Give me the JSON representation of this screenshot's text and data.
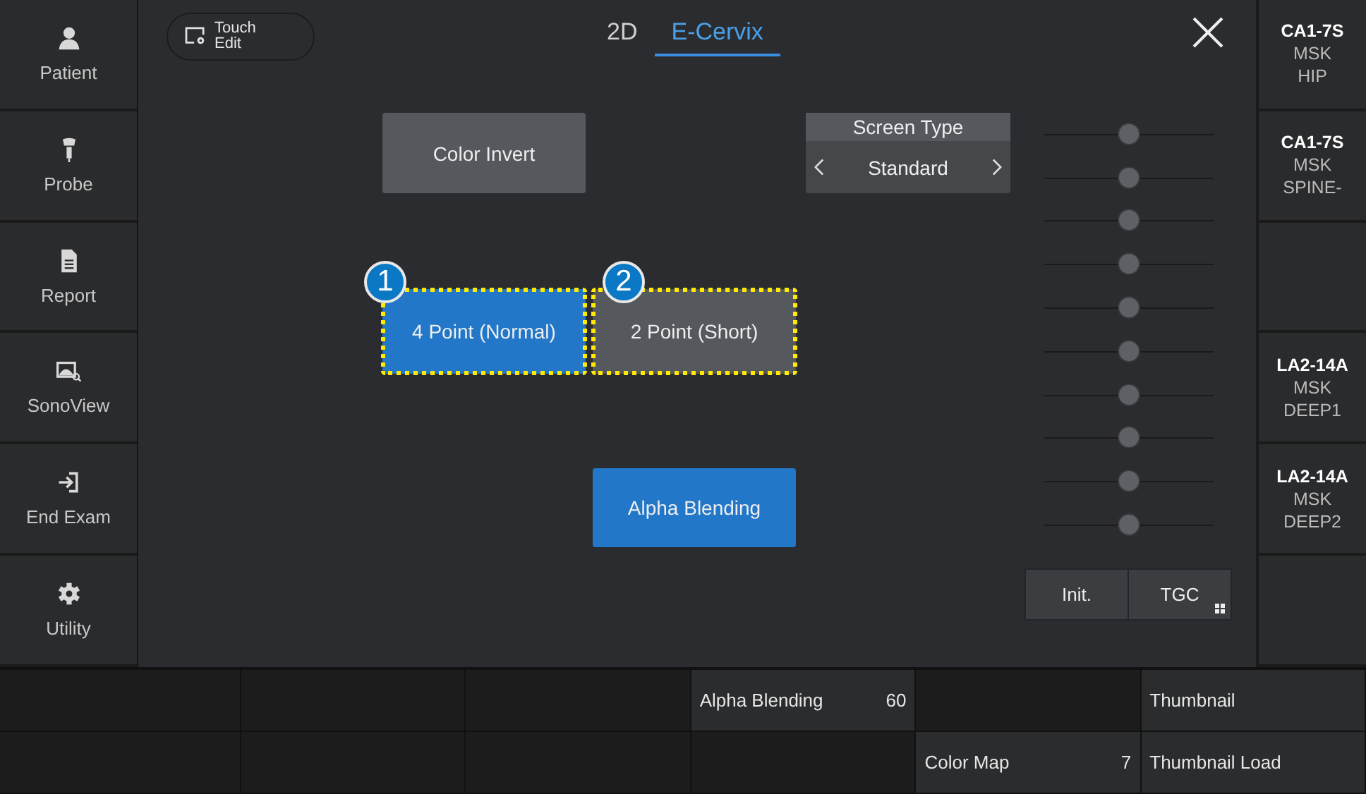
{
  "sidebar": {
    "items": [
      {
        "label": "Patient"
      },
      {
        "label": "Probe"
      },
      {
        "label": "Report"
      },
      {
        "label": "SonoView"
      },
      {
        "label": "End Exam"
      },
      {
        "label": "Utility"
      }
    ]
  },
  "touch_edit": {
    "lines": [
      "Touch",
      "Edit"
    ]
  },
  "tabs": [
    {
      "label": "2D",
      "selected": false
    },
    {
      "label": "E-Cervix",
      "selected": true
    }
  ],
  "color_invert": {
    "label": "Color Invert",
    "on": false
  },
  "screen_type": {
    "title": "Screen Type",
    "value": "Standard"
  },
  "measure_options": [
    {
      "badge": "1",
      "label": "4 Point (Normal)",
      "selected": true,
      "highlighted": true
    },
    {
      "badge": "2",
      "label": "2 Point (Short)",
      "selected": false,
      "highlighted": true
    }
  ],
  "alpha_blending": {
    "label": "Alpha Blending",
    "on": true
  },
  "tgc": {
    "sliders": [
      {
        "level": 0.5
      },
      {
        "level": 0.5
      },
      {
        "level": 0.5
      },
      {
        "level": 0.5
      },
      {
        "level": 0.5
      },
      {
        "level": 0.5
      },
      {
        "level": 0.5
      },
      {
        "level": 0.5
      },
      {
        "level": 0.5
      },
      {
        "level": 0.5
      }
    ],
    "buttons": [
      "Init.",
      "TGC"
    ]
  },
  "probe_presets": [
    {
      "kind": "preset",
      "probe": "CA1-7S",
      "lines": [
        "MSK",
        "HIP"
      ]
    },
    {
      "kind": "preset",
      "probe": "CA1-7S",
      "lines": [
        "MSK",
        "SPINE-"
      ]
    },
    {
      "kind": "empty"
    },
    {
      "kind": "preset",
      "probe": "LA2-14A",
      "lines": [
        "MSK",
        "DEEP1"
      ]
    },
    {
      "kind": "preset",
      "probe": "LA2-14A",
      "lines": [
        "MSK",
        "DEEP2"
      ]
    },
    {
      "kind": "empty"
    }
  ],
  "bottom_grid": [
    [
      {
        "kind": "empty"
      },
      {
        "kind": "empty"
      },
      {
        "kind": "empty"
      },
      {
        "kind": "param",
        "label": "Alpha Blending",
        "value": "60"
      },
      {
        "kind": "empty"
      },
      {
        "kind": "action",
        "label": "Thumbnail"
      }
    ],
    [
      {
        "kind": "empty"
      },
      {
        "kind": "empty"
      },
      {
        "kind": "empty"
      },
      {
        "kind": "empty"
      },
      {
        "kind": "param",
        "label": "Color Map",
        "value": "7"
      },
      {
        "kind": "action",
        "label": "Thumbnail Load"
      }
    ]
  ]
}
